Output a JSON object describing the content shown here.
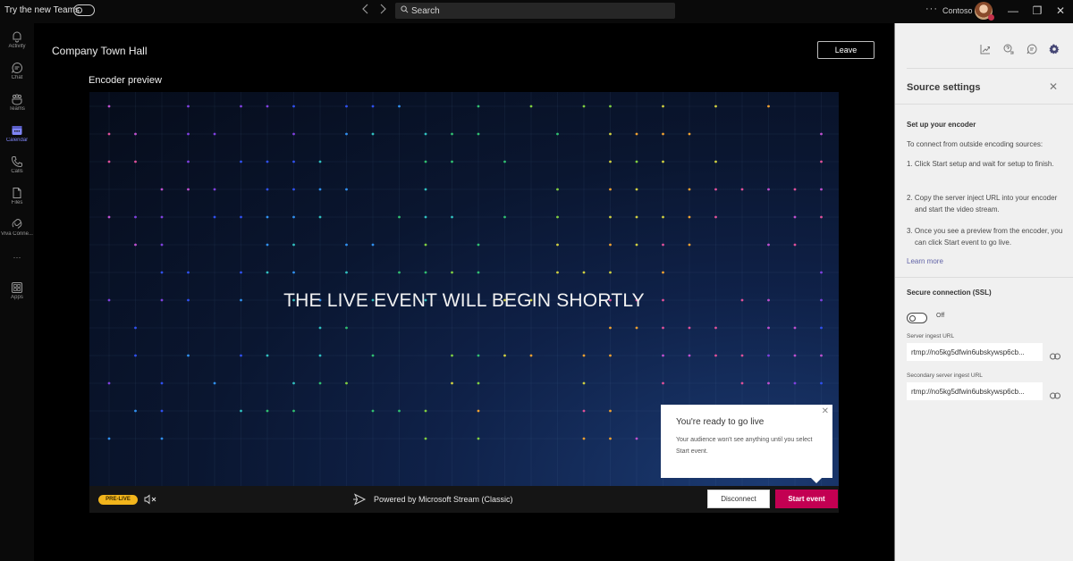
{
  "titlebar": {
    "try_new_teams_label": "Try the new Teams",
    "try_new_teams_toggle": false,
    "back_icon": "chevron-left-icon",
    "forward_icon": "chevron-right-icon",
    "search_placeholder": "Search",
    "more_label": "···",
    "org_name": "Contoso",
    "minimize_glyph": "—",
    "maximize_glyph": "❐",
    "close_glyph": "✕"
  },
  "rail": {
    "items": [
      {
        "label": "Activity",
        "icon": "bell-icon"
      },
      {
        "label": "Chat",
        "icon": "chat-icon"
      },
      {
        "label": "Teams",
        "icon": "teams-icon"
      },
      {
        "label": "Calendar",
        "icon": "calendar-icon",
        "active": true
      },
      {
        "label": "Calls",
        "icon": "phone-icon"
      },
      {
        "label": "Files",
        "icon": "file-icon"
      },
      {
        "label": "Viva Conne...",
        "icon": "viva-icon"
      },
      {
        "label": "···",
        "icon": "more-icon"
      },
      {
        "label": "Apps",
        "icon": "apps-icon"
      }
    ]
  },
  "main": {
    "event_title": "Company Town Hall",
    "leave_label": "Leave",
    "encoder_label": "Encoder preview",
    "video_headline": "THE LIVE EVENT WILL BEGIN SHORTLY",
    "status_badge": "PRE-LIVE",
    "powered_by": "Powered by Microsoft Stream (Classic)",
    "disconnect_label": "Disconnect",
    "start_event_label": "Start event",
    "popover": {
      "title": "You're ready to go live",
      "body": "Your audience won't see anything until you select Start event.",
      "close_glyph": "✕"
    }
  },
  "colors": {
    "accent": "#6264a7",
    "start_event": "#c30052",
    "prelive_badge": "#f2b51c",
    "calendar_active": "#7f85f5"
  },
  "panel": {
    "title": "Source settings",
    "close_glyph": "✕",
    "setup_heading": "Set up your encoder",
    "intro": "To connect from outside encoding sources:",
    "steps": [
      "1. Click Start setup and wait for setup to finish.",
      "2. Copy the server inject URL into your encoder and start the video stream.",
      "3. Once you see a preview from the encoder, you can click Start event to go live."
    ],
    "learn_more": "Learn more",
    "ssl_heading": "Secure connection (SSL)",
    "ssl_state": "Off",
    "server_url_label": "Server ingest URL",
    "server_url_value": "rtmp://no5kg5dfwin6ubskywsp6cb...",
    "secondary_url_label": "Secondary server ingest URL",
    "secondary_url_value": "rtmp://no5kg5dfwin6ubskywsp6cb..."
  }
}
